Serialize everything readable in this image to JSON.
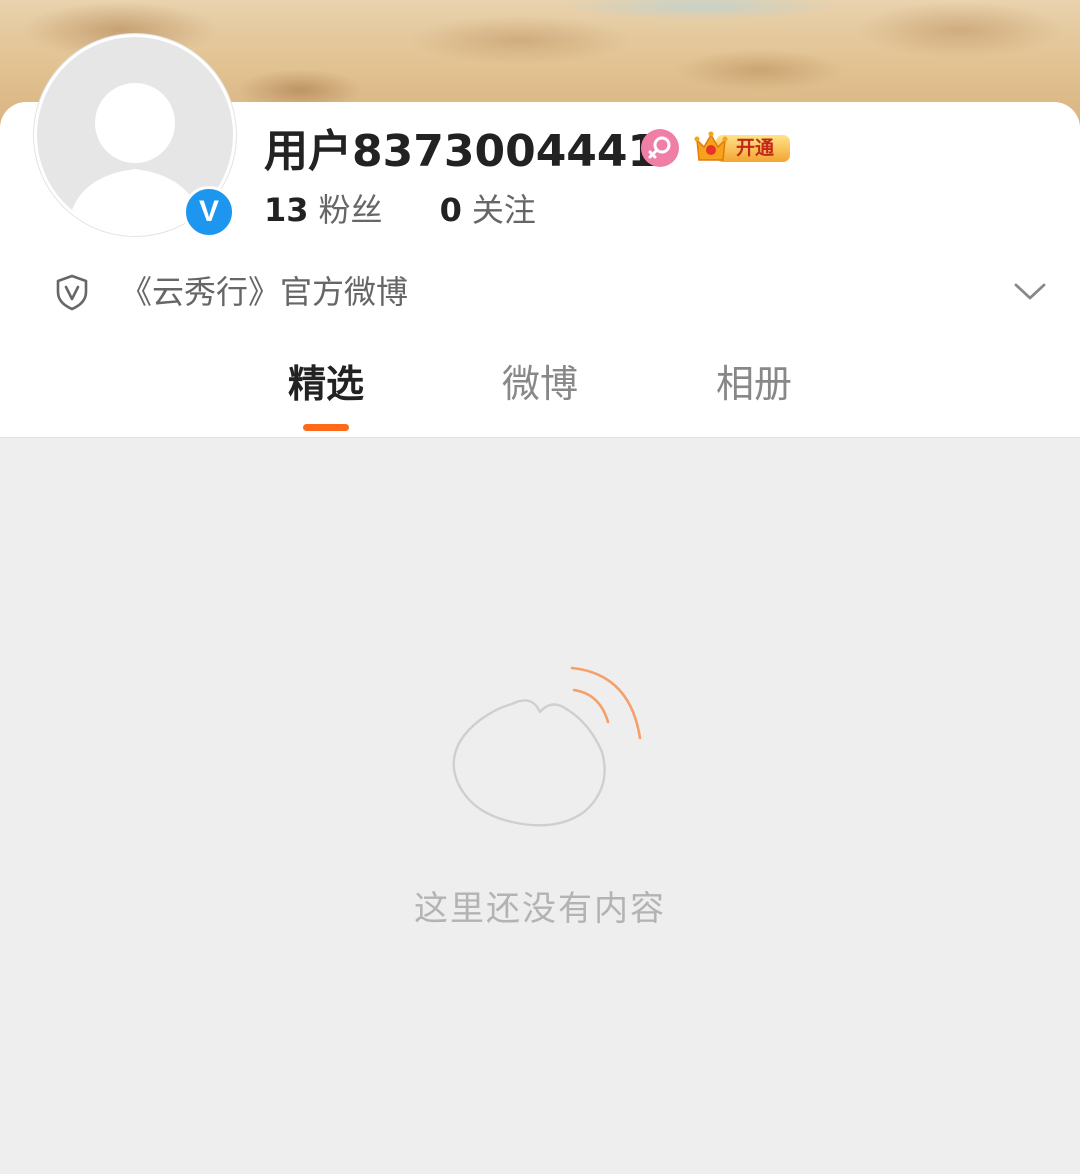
{
  "profile": {
    "username": "用户8373004441",
    "vip_label": "开通",
    "verified_badge": "V"
  },
  "stats": [
    {
      "value": "13",
      "label": "粉丝"
    },
    {
      "value": "0",
      "label": "关注"
    }
  ],
  "description": "《云秀行》官方微博",
  "tabs": [
    {
      "label": "精选",
      "active": true
    },
    {
      "label": "微博",
      "active": false
    },
    {
      "label": "相册",
      "active": false
    }
  ],
  "empty_state": {
    "message": "这里还没有内容"
  },
  "colors": {
    "accent": "#ff6a1a",
    "verified": "#1d96ef",
    "gender_female": "#f07fa7",
    "vip_gold": "#f6b23c"
  },
  "icons": [
    "avatar-placeholder",
    "verified-icon",
    "female-gender-icon",
    "crown-icon",
    "shield-v-icon",
    "chevron-down-icon",
    "weibo-logo-icon"
  ]
}
